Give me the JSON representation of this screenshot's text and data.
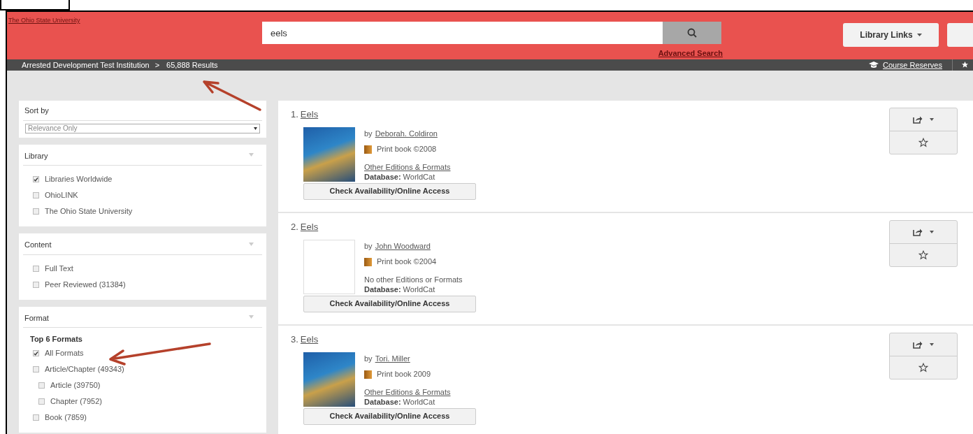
{
  "header": {
    "logo_link": "The Ohio State University",
    "search": {
      "value": "eels"
    },
    "advanced_search": "Advanced Search",
    "library_links": "Library Links"
  },
  "breadcrumb": {
    "institution": "Arrested Development Test Institution",
    "separator": ">",
    "results": "65,888 Results"
  },
  "toolbar": {
    "course_reserves": "Course Reserves"
  },
  "sidebar": {
    "sort": {
      "label": "Sort by",
      "value": "Relevance Only"
    },
    "facets": [
      {
        "title": "Library",
        "items": [
          {
            "label": "Libraries Worldwide",
            "checked": true
          },
          {
            "label": "OhioLINK",
            "checked": false
          },
          {
            "label": "The Ohio State University",
            "checked": false
          }
        ]
      },
      {
        "title": "Content",
        "items": [
          {
            "label": "Full Text",
            "checked": false
          },
          {
            "label": "Peer Reviewed (31384)",
            "checked": false
          }
        ]
      },
      {
        "title": "Format",
        "heading": "Top 6 Formats",
        "items": [
          {
            "label": "All Formats",
            "checked": true
          },
          {
            "label": "Article/Chapter (49343)",
            "checked": false,
            "children": [
              {
                "label": "Article (39750)",
                "checked": false
              },
              {
                "label": "Chapter (7952)",
                "checked": false
              }
            ]
          },
          {
            "label": "Book (7859)",
            "checked": false
          }
        ]
      }
    ]
  },
  "results": [
    {
      "number": "1.",
      "title": "Eels",
      "by": "by",
      "author": "Deborah. Coldiron",
      "kind": "photo",
      "format": "Print book ©2008",
      "editions": "Other Editions & Formats",
      "editions_link": true,
      "database_label": "Database:",
      "database": "WorldCat",
      "button": "Check Availability/Online Access"
    },
    {
      "number": "2.",
      "title": "Eels",
      "by": "by",
      "author": "John Woodward",
      "kind": "blank",
      "format": "Print book ©2004",
      "editions": "No other Editions or Formats",
      "editions_link": false,
      "database_label": "Database:",
      "database": "WorldCat",
      "button": "Check Availability/Online Access"
    },
    {
      "number": "3.",
      "title": "Eels",
      "by": "by",
      "author": "Tori. Miller",
      "kind": "photo",
      "format": "Print book 2009",
      "editions": "Other Editions & Formats",
      "editions_link": true,
      "database_label": "Database:",
      "database": "WorldCat",
      "button": "Check Availability/Online Access"
    }
  ]
}
